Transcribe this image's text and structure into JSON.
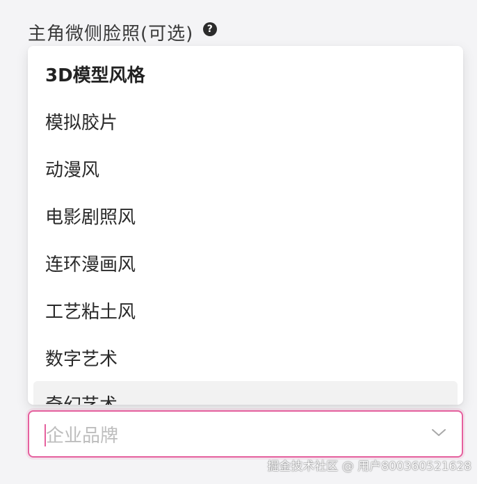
{
  "field": {
    "label": "主角微侧脸照(可选)",
    "help_icon": "question-circle-icon"
  },
  "dropdown": {
    "options": [
      {
        "label": "3D模型风格",
        "state": "selected"
      },
      {
        "label": "模拟胶片",
        "state": "normal"
      },
      {
        "label": "动漫风",
        "state": "normal"
      },
      {
        "label": "电影剧照风",
        "state": "normal"
      },
      {
        "label": "连环漫画风",
        "state": "normal"
      },
      {
        "label": "工艺粘土风",
        "state": "normal"
      },
      {
        "label": "数字艺术",
        "state": "normal"
      },
      {
        "label": "奇幻艺术",
        "state": "hover"
      }
    ]
  },
  "select": {
    "placeholder": "企业品牌",
    "chevron_icon": "chevron-down-icon",
    "focus_color": "#e5609e"
  },
  "watermark": {
    "text": "掘金技术社区 @ 用户800360521628"
  }
}
